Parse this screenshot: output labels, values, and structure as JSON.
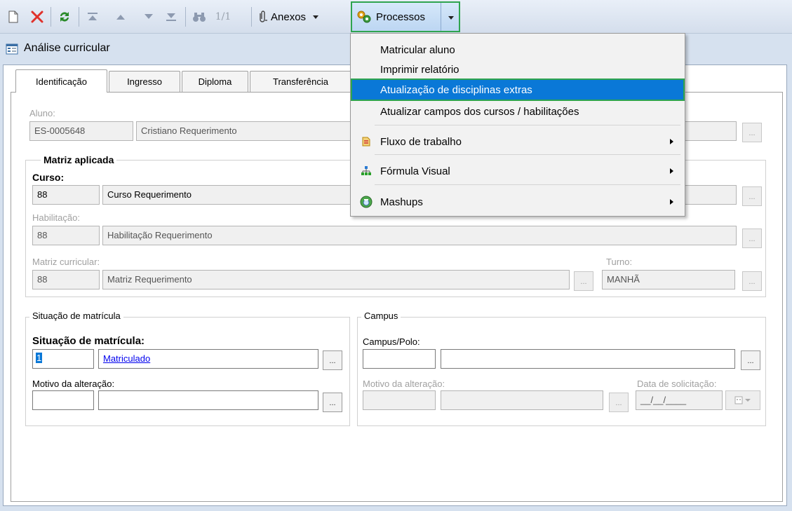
{
  "toolbar": {
    "new_icon": "new-document-icon",
    "delete_icon": "delete-x-icon",
    "refresh_icon": "refresh-icon",
    "record_counter": "1/1",
    "anexos_label": "Anexos",
    "processos_label": "Processos",
    "colors": {
      "delete": "#e0312b",
      "refresh": "#2a8a2a",
      "highlight_border": "#2ea44f",
      "menu_highlight": "#0a78d7"
    }
  },
  "window": {
    "title": "Análise curricular"
  },
  "tabs": [
    {
      "label": "Identificação"
    },
    {
      "label": "Ingresso"
    },
    {
      "label": "Diploma"
    },
    {
      "label": "Transferência"
    }
  ],
  "aluno": {
    "label": "Aluno:",
    "code": "ES-0005648",
    "name": "Cristiano Requerimento"
  },
  "matriz": {
    "group_title": "Matriz aplicada",
    "curso_label": "Curso:",
    "curso_code": "88",
    "curso_name": "Curso Requerimento",
    "habilitacao_label": "Habilitação:",
    "habilitacao_code": "88",
    "habilitacao_name": "Habilitação Requerimento",
    "matriz_label": "Matriz curricular:",
    "matriz_code": "88",
    "matriz_name": "Matriz Requerimento",
    "turno_label": "Turno:",
    "turno_value": "MANHÃ"
  },
  "situacao": {
    "group_title": "Situação de matrícula",
    "label": "Situação de matrícula:",
    "code": "1",
    "value": "Matriculado",
    "motivo_label": "Motivo da alteração:",
    "motivo_code": "",
    "motivo_value": ""
  },
  "campus": {
    "group_title": "Campus",
    "label": "Campus/Polo:",
    "code": "",
    "value": "",
    "motivo_label": "Motivo da alteração:",
    "data_label": "Data de solicitação:",
    "data_value": "__/__/____"
  },
  "menu": {
    "items": [
      {
        "label": "Matricular aluno"
      },
      {
        "label": "Imprimir relatório"
      },
      {
        "label": "Atualização de disciplinas extras"
      },
      {
        "label": "Atualizar campos dos cursos / habilitações"
      },
      {
        "label": "Fluxo de trabalho",
        "icon": "workflow-icon"
      },
      {
        "label": "Fórmula Visual",
        "icon": "formula-visual-icon"
      },
      {
        "label": "Mashups",
        "icon": "mashups-icon"
      }
    ]
  }
}
